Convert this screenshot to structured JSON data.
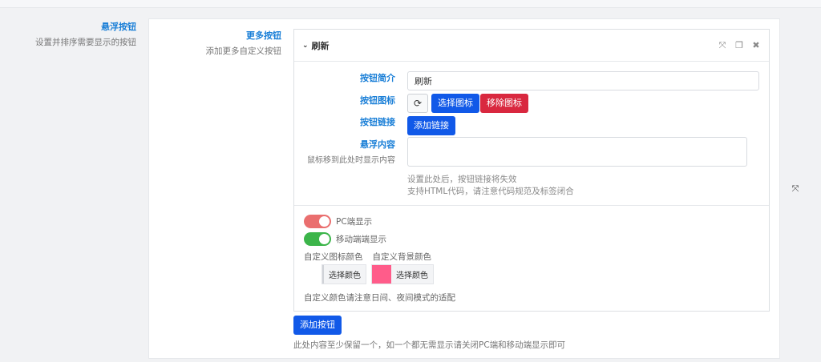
{
  "section": {
    "title": "悬浮按钮",
    "description": "设置并排序需要显示的按钮"
  },
  "sub_section": {
    "title": "更多按钮",
    "description": "添加更多自定义按钮"
  },
  "item": {
    "name": "刷新",
    "expand_icon": "chevron-down-icon",
    "head_icons": [
      "fullscreen-icon",
      "copy-icon",
      "close-icon"
    ]
  },
  "fields": {
    "intro_label": "按钮简介",
    "intro_value": "刷新",
    "icon_label": "按钮图标",
    "icon_glyph": "refresh-icon",
    "select_icon_button": "选择图标",
    "remove_icon_button": "移除图标",
    "link_label": "按钮链接",
    "add_link_button": "添加链接",
    "hover_label": "悬浮内容",
    "hover_desc": "鼠标移到此处时显示内容",
    "hover_value": "",
    "help_line1": "设置此处后，按钮链接将失效",
    "help_line2": "支持HTML代码，请注意代码规范及标签闭合"
  },
  "toggles": {
    "pc_label": "PC端显示",
    "pc_on": false,
    "mobile_label": "移动端端显示",
    "mobile_on": true
  },
  "colors": {
    "icon_color_label": "自定义图标颜色",
    "bg_color_label": "自定义背景颜色",
    "icon_color_button": "选择颜色",
    "bg_color_button": "选择颜色",
    "icon_color_value": "",
    "bg_color_value": "#ff5c8a",
    "note": "自定义颜色请注意日间、夜间模式的适配"
  },
  "footer": {
    "add_button": "添加按钮",
    "note": "此处内容至少保留一个，如一个都无需显示请关闭PC端和移动端显示即可"
  },
  "theme": {
    "accent": "#1159e8",
    "danger": "#d9283f",
    "label_blue": "#1a7fd7",
    "toggle_off": "#ea6f6f",
    "toggle_on": "#3cb54a"
  }
}
